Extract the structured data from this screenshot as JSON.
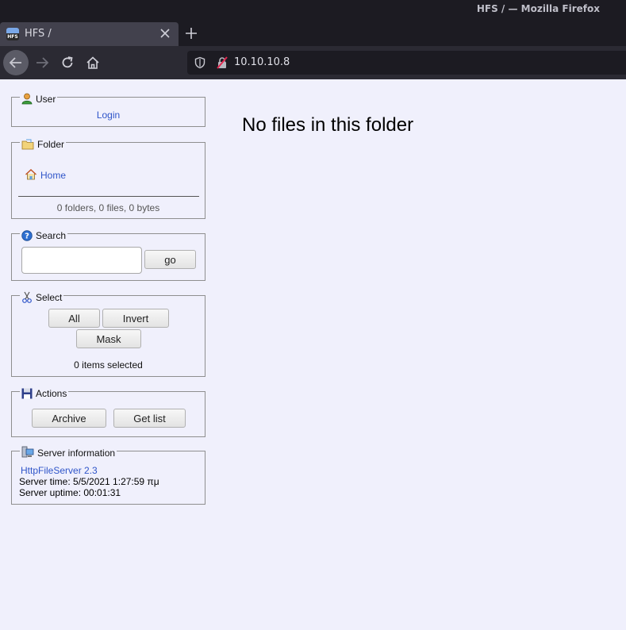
{
  "window": {
    "title": "HFS / — Mozilla Firefox"
  },
  "tab": {
    "label": "HFS /",
    "favicon_text": "HFS"
  },
  "urlbar": {
    "url": "10.10.10.8"
  },
  "icons": {
    "back": "arrow-left-icon",
    "forward": "arrow-right-icon",
    "reload": "reload-icon",
    "home": "home-icon",
    "shield": "shield-icon",
    "insecure": "insecure-lock-icon"
  },
  "colors": {
    "page_bg": "#f0f0fc",
    "link": "#2f55c9",
    "chrome_dark": "#1c1b22"
  },
  "sidebar": {
    "user": {
      "title": "User",
      "login": "Login"
    },
    "folder": {
      "title": "Folder",
      "home": "Home",
      "stats": "0 folders, 0 files, 0 bytes"
    },
    "search": {
      "title": "Search",
      "input_value": "",
      "go": "go"
    },
    "select": {
      "title": "Select",
      "all": "All",
      "invert": "Invert",
      "mask": "Mask",
      "count": "0 items selected"
    },
    "actions": {
      "title": "Actions",
      "archive": "Archive",
      "get_list": "Get list"
    },
    "server": {
      "title": "Server information",
      "link": "HttpFileServer 2.3",
      "time": "Server time: 5/5/2021 1:27:59 πμ",
      "uptime": "Server uptime: 00:01:31"
    }
  },
  "main": {
    "message": "No files in this folder"
  }
}
